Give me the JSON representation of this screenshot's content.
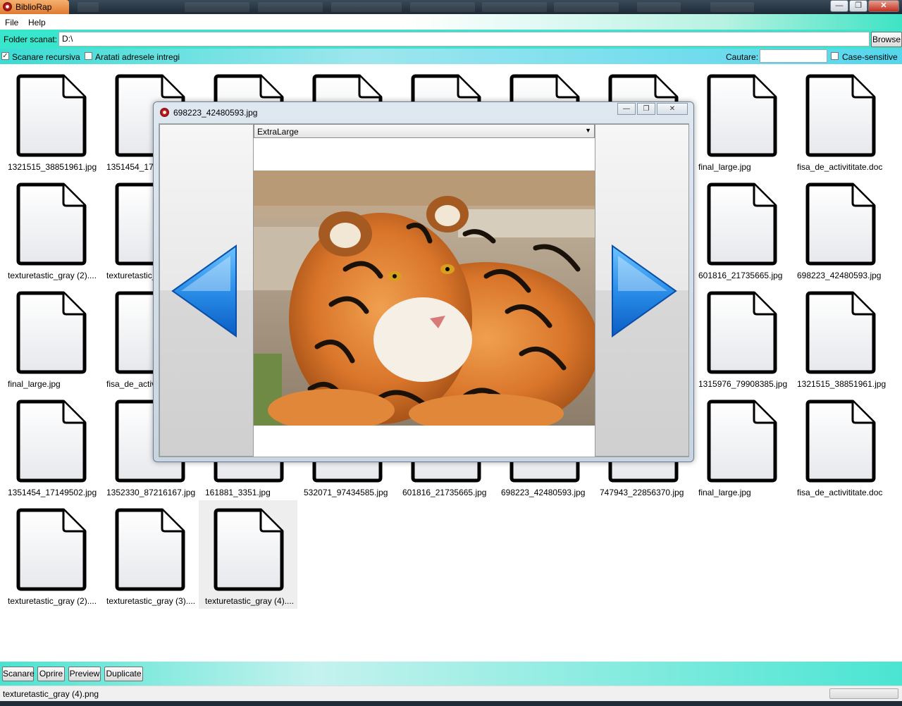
{
  "window": {
    "title": "BiblioRap"
  },
  "taskbar_tabs": [
    "",
    "",
    "",
    "",
    "",
    "",
    "",
    "",
    ""
  ],
  "menu": {
    "file": "File",
    "help": "Help"
  },
  "folder": {
    "label": "Folder scanat:",
    "path": "D:\\",
    "browse": "Browse"
  },
  "options": {
    "recursive_label": "Scanare recursiva",
    "recursive_checked": true,
    "full_paths_label": "Aratati adresele intregi",
    "full_paths_checked": false,
    "search_label": "Cautare:",
    "search_value": "",
    "case_label": "Case-sensitive",
    "case_checked": false
  },
  "files": [
    [
      "1321515_38851961.jpg",
      "1351454_17149502.jpg",
      "",
      "",
      "",
      "",
      "",
      "final_large.jpg",
      "fisa_de_activititate.doc"
    ],
    [
      "texturetastic_gray (2)....",
      "texturetastic_gray (3)....",
      "",
      "",
      "",
      "",
      "",
      "601816_21735665.jpg",
      "698223_42480593.jpg"
    ],
    [
      "final_large.jpg",
      "fisa_de_activititate.doc",
      "",
      "",
      "",
      "",
      "",
      "1315976_79908385.jpg",
      "1321515_38851961.jpg"
    ],
    [
      "1351454_17149502.jpg",
      "1352330_87216167.jpg",
      "161881_3351.jpg",
      "532071_97434585.jpg",
      "601816_21735665.jpg",
      "698223_42480593.jpg",
      "747943_22856370.jpg",
      "final_large.jpg",
      "fisa_de_activititate.doc"
    ],
    [
      "texturetastic_gray (2)....",
      "texturetastic_gray (3)....",
      "texturetastic_gray (4)...."
    ]
  ],
  "buttons": {
    "scan": "Scanare",
    "stop": "Oprire",
    "preview": "Preview",
    "duplicates": "Duplicate"
  },
  "status": {
    "text": "texturetastic_gray (4).png",
    "progress": 0
  },
  "preview": {
    "title": "698223_42480593.jpg",
    "size_option": "ExtraLarge",
    "colors": {
      "arrow": "#2a8ee8",
      "arrow_dark": "#0b5cc4"
    }
  }
}
